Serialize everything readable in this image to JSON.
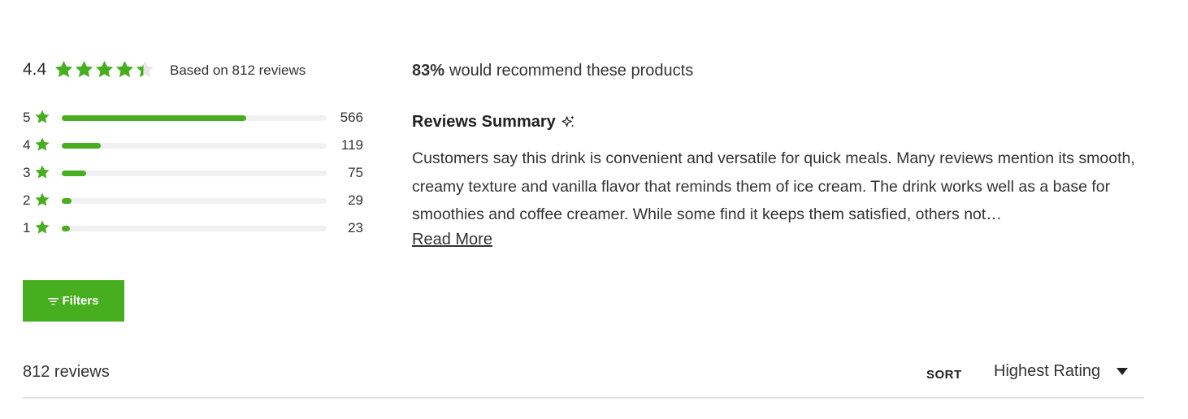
{
  "rating": {
    "average": "4.4",
    "average_value": 4.4,
    "star_fill_fraction": 0.88,
    "based_on": "Based on 812 reviews",
    "color_accent": "#47ae20",
    "color_track": "#f1f1f3",
    "histogram": [
      {
        "stars": "5",
        "count": "566",
        "fraction": 0.697
      },
      {
        "stars": "4",
        "count": "119",
        "fraction": 0.147
      },
      {
        "stars": "3",
        "count": "75",
        "fraction": 0.092
      },
      {
        "stars": "2",
        "count": "29",
        "fraction": 0.036
      },
      {
        "stars": "1",
        "count": "23",
        "fraction": 0.028
      }
    ]
  },
  "filters_button": {
    "label": "Filters",
    "icon": "filter-lines-icon"
  },
  "recommend": {
    "percent": "83%",
    "text": "would recommend these products"
  },
  "summary": {
    "title": "Reviews Summary",
    "title_icon": "sparkle-icon",
    "body": "Customers say this drink is convenient and versatile for quick meals. Many reviews mention its smooth, creamy texture and vanilla flavor that reminds them of ice cream. The drink works well as a base for smoothies and coffee creamer. While some find it keeps them satisfied, others not…",
    "read_more": "Read More"
  },
  "list_header": {
    "count": "812 reviews",
    "sort_label": "SORT",
    "sort_value": "Highest Rating",
    "sort_icon": "caret-down-icon"
  }
}
